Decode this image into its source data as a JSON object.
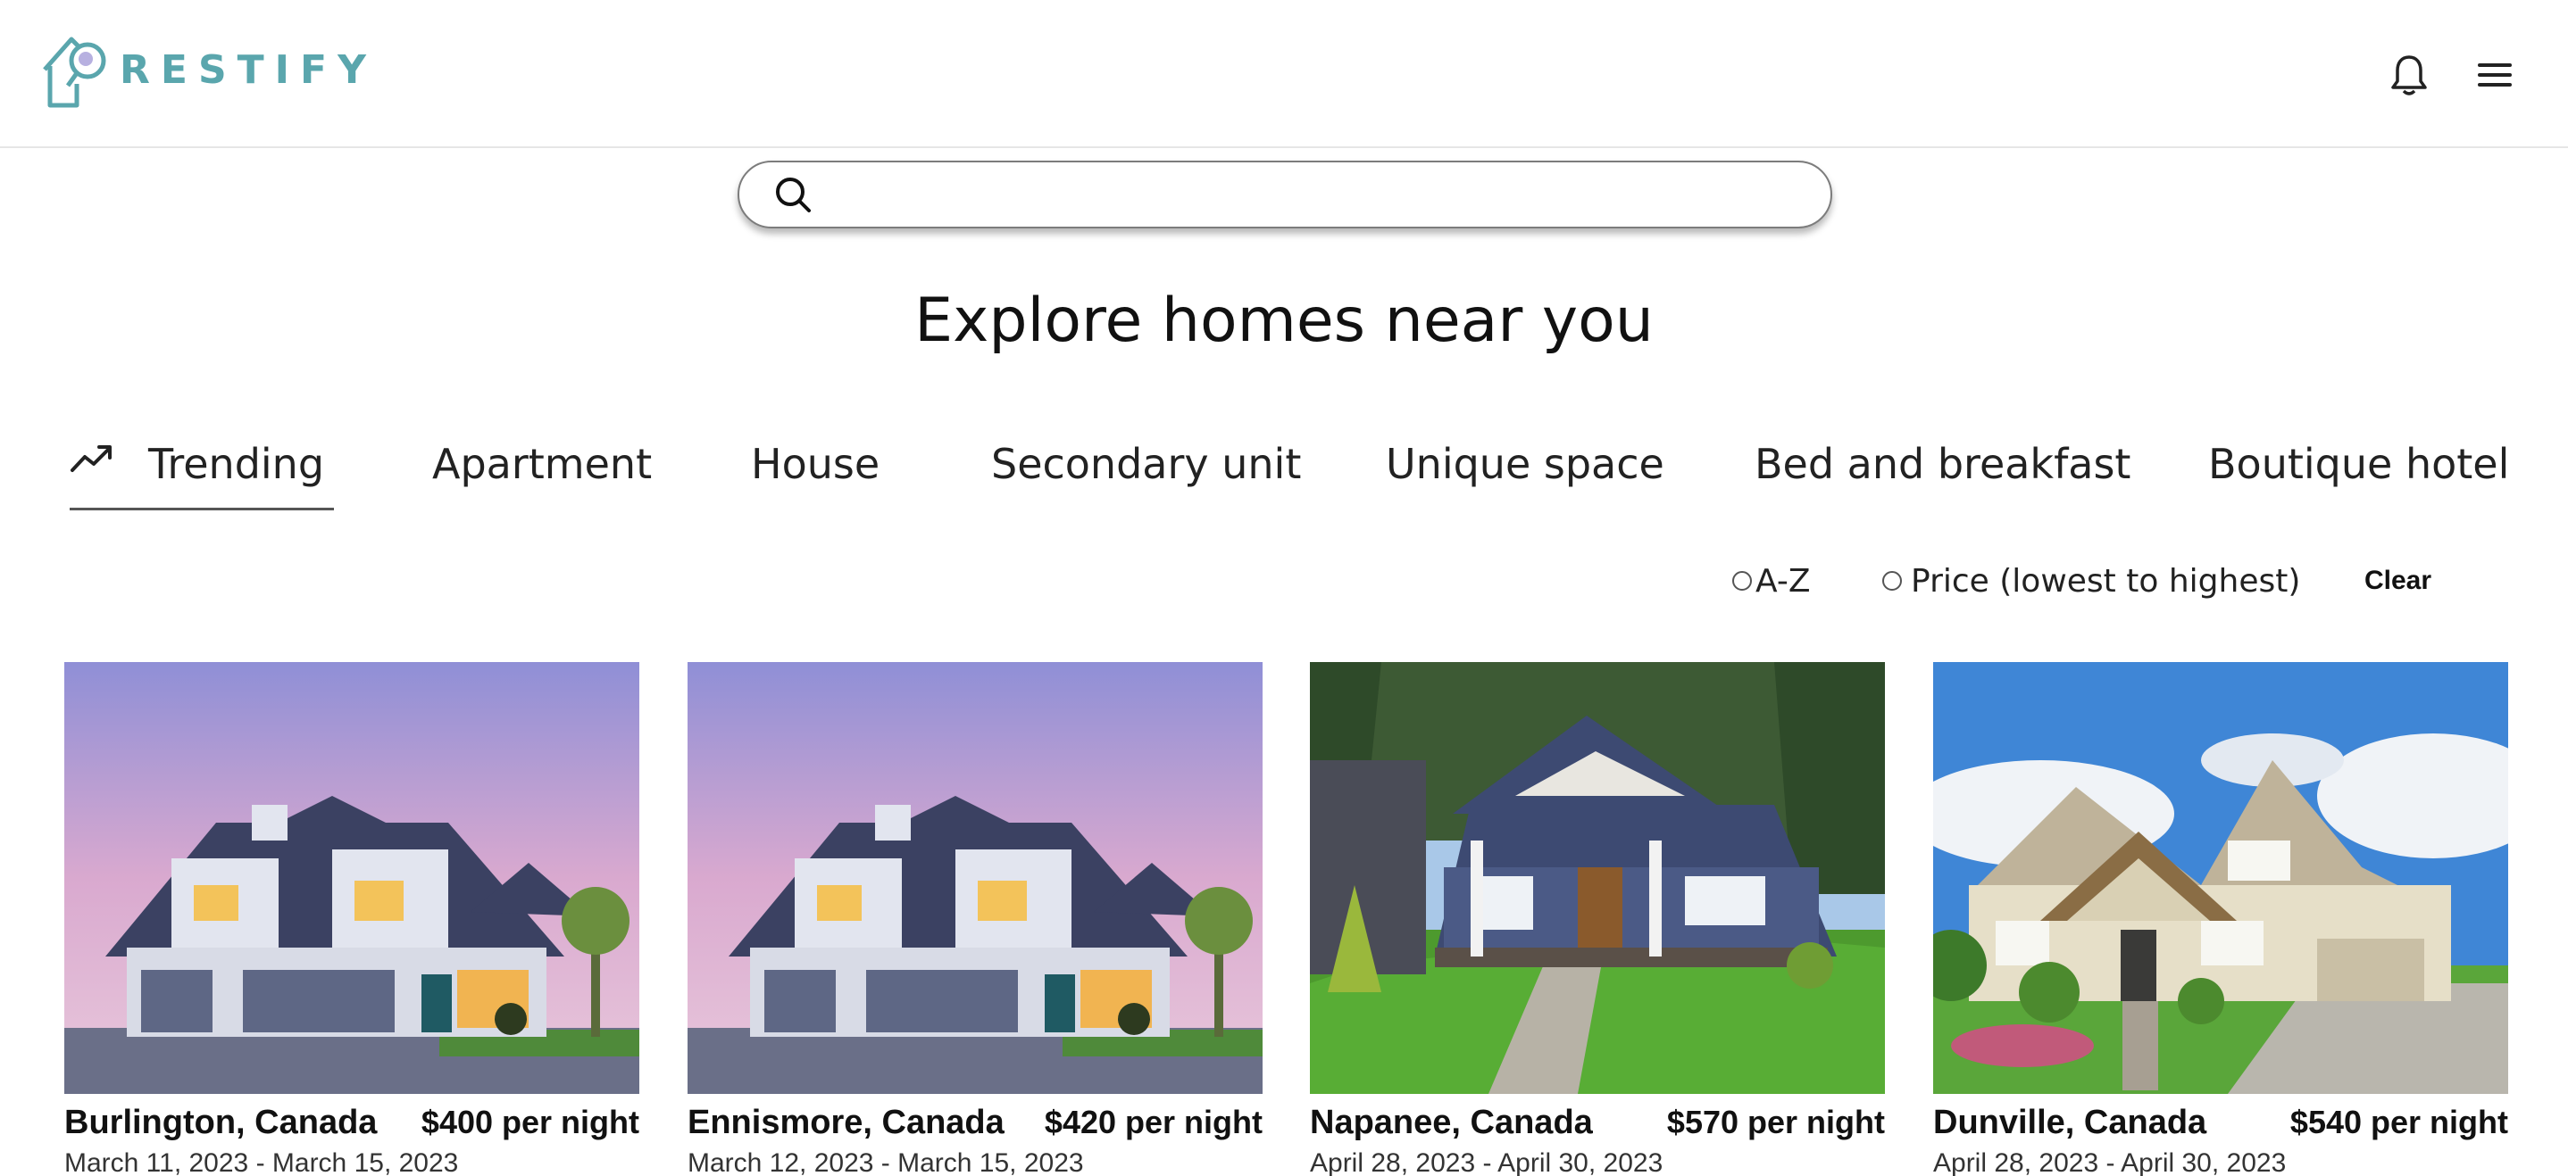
{
  "app": {
    "brand": "RESTIFY",
    "brand_color": "#5aa6ad"
  },
  "header": {
    "notifications_icon": "bell-icon",
    "menu_icon": "hamburger-menu-icon"
  },
  "search": {
    "placeholder": "",
    "value": "",
    "icon": "search-icon"
  },
  "page": {
    "title": "Explore homes near you"
  },
  "tabs": [
    {
      "label": "Trending",
      "icon": "trending-up-icon",
      "active": true
    },
    {
      "label": "Apartment"
    },
    {
      "label": "House"
    },
    {
      "label": "Secondary unit"
    },
    {
      "label": "Unique space"
    },
    {
      "label": "Bed and breakfast"
    },
    {
      "label": "Boutique hotel"
    }
  ],
  "sort": {
    "options": [
      {
        "label": "A-Z",
        "checked": false
      },
      {
        "label": "Price (lowest to highest)",
        "checked": false
      }
    ],
    "clear_label": "Clear"
  },
  "listings": [
    {
      "city": "Burlington, Canada",
      "price": "$400 per night",
      "dates": "March 11, 2023 - March 15, 2023",
      "image": "house-dusk-photo"
    },
    {
      "city": "Ennismore, Canada",
      "price": "$420 per night",
      "dates": "March 12, 2023 - March 15, 2023",
      "image": "house-dusk-photo"
    },
    {
      "city": "Napanee, Canada",
      "price": "$570 per night",
      "dates": "April 28, 2023 - April 30, 2023",
      "image": "craftsman-house-photo"
    },
    {
      "city": "Dunville, Canada",
      "price": "$540 per night",
      "dates": "April 28, 2023 - April 30, 2023",
      "image": "beige-house-photo"
    }
  ]
}
